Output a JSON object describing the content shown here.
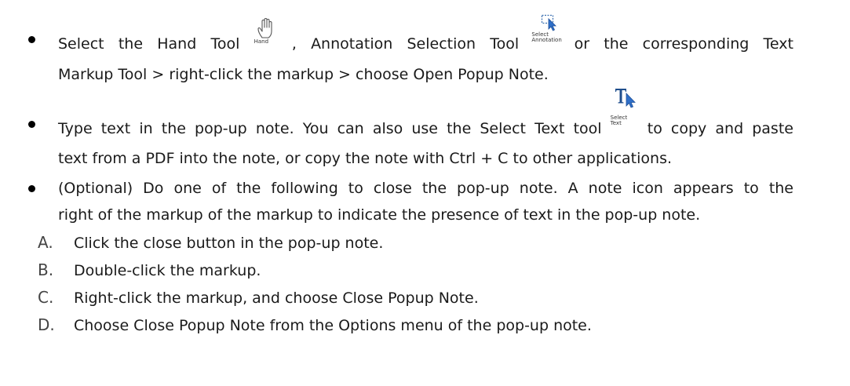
{
  "bullets": [
    {
      "line1_a": "Select the Hand Tool",
      "hand_label": "Hand",
      "line1_b": ", Annotation Selection Tool",
      "annot_label_1": "Select",
      "annot_label_2": "Annotation",
      "line1_c": "or the corresponding Text",
      "line2": "Markup Tool > right-click the markup > choose Open Popup Note."
    },
    {
      "line1_a": "Type text in the pop-up note. You can also use the Select Text tool",
      "select_label_1": "Select",
      "select_label_2": "Text",
      "line1_b": "to copy and paste",
      "line2": "text from a PDF into the note, or copy the note with Ctrl + C to other applications."
    },
    {
      "line1": "(Optional) Do one of the following to close the pop-up note. A note icon appears to the",
      "line2": "right of the markup of the markup to indicate the presence of text in the pop-up note."
    }
  ],
  "sub_items": [
    {
      "letter": "A.",
      "text": "Click the close button in the pop-up note."
    },
    {
      "letter": "B.",
      "text": "Double-click the markup."
    },
    {
      "letter": "C.",
      "text": "Right-click the markup, and choose Close Popup Note."
    },
    {
      "letter": "D.",
      "text": "Choose Close Popup Note from the Options menu of the pop-up note."
    }
  ],
  "icons": {
    "hand": "hand-icon",
    "annotation_selection": "annotation-selection-icon",
    "select_text": "select-text-icon",
    "bullet": "bullet-icon"
  }
}
